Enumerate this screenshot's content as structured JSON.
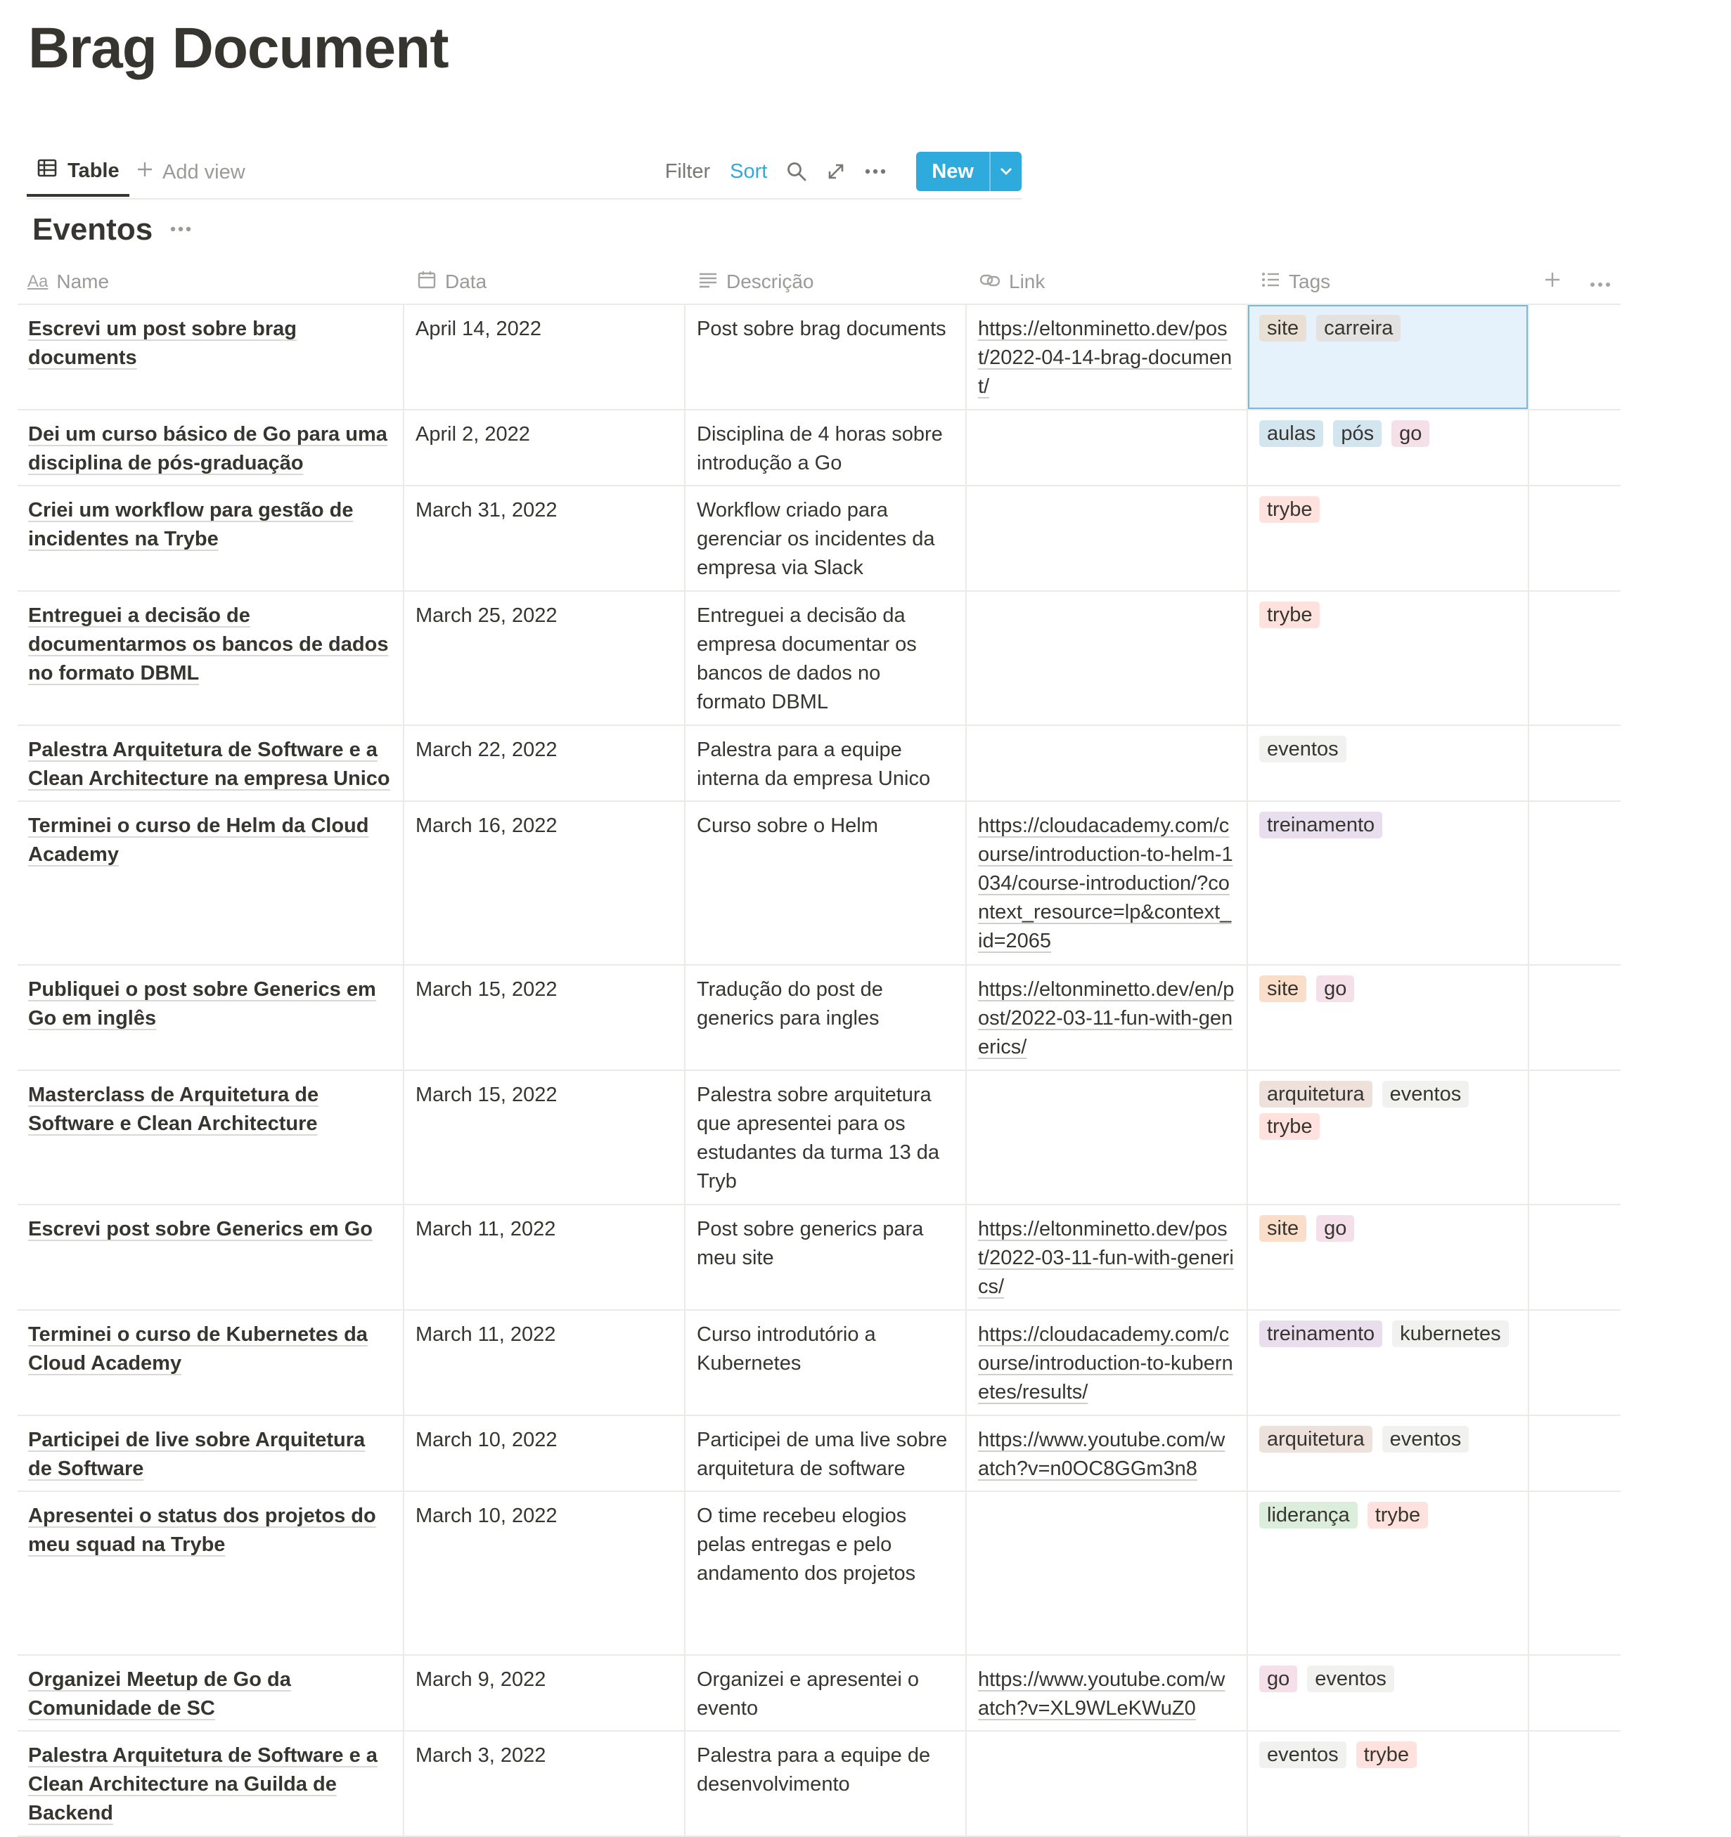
{
  "page": {
    "title": "Brag Document"
  },
  "toolbar": {
    "view_label": "Table",
    "add_view_label": "Add view",
    "filter_label": "Filter",
    "sort_label": "Sort",
    "new_label": "New"
  },
  "group": {
    "title": "Eventos"
  },
  "columns": [
    "Name",
    "Data",
    "Descrição",
    "Link",
    "Tags"
  ],
  "tag_colors": {
    "site": "#e9e0d3",
    "carreira": "#e3e2e0",
    "aulas": "#d3e5ef",
    "pós": "#d3e5ef",
    "go": "#f5e0e9",
    "trybe": "#ffe2dd",
    "eventos": "#f1f1ef",
    "treinamento": "#e8deee",
    "site_orange": "#fadec9",
    "arquitetura": "#eee0da",
    "kubernetes": "#f1f1ef",
    "liderança": "#dbeddb"
  },
  "rows": [
    {
      "name": "Escrevi um post sobre brag documents",
      "date": "April 14, 2022",
      "desc": "Post sobre brag documents",
      "link": "https://eltonminetto.dev/post/2022-04-14-brag-document/",
      "tags": [
        [
          "site",
          "#e9e0d3"
        ],
        [
          "carreira",
          "#e3e2e0"
        ]
      ],
      "selected": true,
      "height": 90
    },
    {
      "name": "Dei um curso básico de Go para uma disciplina de pós-graduação",
      "date": "April 2, 2022",
      "desc": "Disciplina de 4 horas sobre introdução a Go",
      "link": "",
      "tags": [
        [
          "aulas",
          "#d3e5ef"
        ],
        [
          "pós",
          "#d3e5ef"
        ],
        [
          "go",
          "#f5e0e9"
        ]
      ],
      "height": 65
    },
    {
      "name": "Criei um workflow para gestão de incidentes na Trybe",
      "date": "March 31, 2022",
      "desc": "Workflow criado para gerenciar os incidentes da empresa via Slack",
      "link": "",
      "tags": [
        [
          "trybe",
          "#ffe2dd"
        ]
      ],
      "height": 90
    },
    {
      "name": "Entreguei a decisão de documentarmos os bancos de dados no formato DBML",
      "date": "March 25, 2022",
      "desc": "Entreguei a decisão da empresa documentar os bancos de dados no formato DBML",
      "link": "",
      "tags": [
        [
          "trybe",
          "#ffe2dd"
        ]
      ],
      "height": 115
    },
    {
      "name": "Palestra Arquitetura de Software e a Clean Architecture na empresa Unico",
      "date": "March 22, 2022",
      "desc": "Palestra para a equipe interna da empresa Unico",
      "link": "",
      "tags": [
        [
          "eventos",
          "#f1f1ef"
        ]
      ],
      "height": 65
    },
    {
      "name": "Terminei o curso de Helm da Cloud Academy",
      "date": "March 16, 2022",
      "desc": "Curso sobre o Helm",
      "link": "https://cloudacademy.com/course/introduction-to-helm-1034/course-introduction/?context_resource=lp&context_id=2065",
      "tags": [
        [
          "treinamento",
          "#e8deee"
        ]
      ],
      "height": 140
    },
    {
      "name": "Publiquei o post sobre Generics em Go em inglês",
      "date": "March 15, 2022",
      "desc": "Tradução do post de generics para ingles",
      "link": "https://eltonminetto.dev/en/post/2022-03-11-fun-with-generics/",
      "tags": [
        [
          "site",
          "#fadec9"
        ],
        [
          "go",
          "#f5e0e9"
        ]
      ],
      "height": 90
    },
    {
      "name": "Masterclass de Arquitetura de Software e Clean Architecture",
      "date": "March 15, 2022",
      "desc": "Palestra sobre arquitetura que apresentei para os estudantes da turma 13 da Tryb",
      "link": "",
      "tags": [
        [
          "arquitetura",
          "#eee0da"
        ],
        [
          "eventos",
          "#f1f1ef"
        ],
        [
          "trybe",
          "#ffe2dd"
        ]
      ],
      "height": 115
    },
    {
      "name": "Escrevi post sobre Generics em Go",
      "date": "March 11, 2022",
      "desc": "Post sobre generics para meu site",
      "link": "https://eltonminetto.dev/post/2022-03-11-fun-with-generics/",
      "tags": [
        [
          "site",
          "#fadec9"
        ],
        [
          "go",
          "#f5e0e9"
        ]
      ],
      "height": 90
    },
    {
      "name": "Terminei o curso de Kubernetes da Cloud Academy",
      "date": "March 11, 2022",
      "desc": "Curso introdutório a Kubernetes",
      "link": "https://cloudacademy.com/course/introduction-to-kubernetes/results/",
      "tags": [
        [
          "treinamento",
          "#e8deee"
        ],
        [
          "kubernetes",
          "#f1f1ef"
        ]
      ],
      "height": 90
    },
    {
      "name": "Participei de live sobre Arquitetura de Software",
      "date": "March 10, 2022",
      "desc": "Participei de uma live sobre arquitetura de software",
      "link": "https://www.youtube.com/watch?v=n0OC8GGm3n8",
      "tags": [
        [
          "arquitetura",
          "#eee0da"
        ],
        [
          "eventos",
          "#f1f1ef"
        ]
      ],
      "height": 65
    },
    {
      "name": "Apresentei o status dos projetos do meu squad na Trybe",
      "date": "March 10, 2022",
      "desc": "O time recebeu elogios pelas entregas e pelo andamento dos projetos",
      "link": "",
      "tags": [
        [
          "liderança",
          "#dbeddb"
        ],
        [
          "trybe",
          "#ffe2dd"
        ]
      ],
      "height": 140
    },
    {
      "name": "Organizei Meetup de Go da Comunidade de SC",
      "date": "March 9, 2022",
      "desc": "Organizei e apresentei o evento",
      "link": "https://www.youtube.com/watch?v=XL9WLeKWuZ0",
      "tags": [
        [
          "go",
          "#f5e0e9"
        ],
        [
          "eventos",
          "#f1f1ef"
        ]
      ],
      "height": 65
    },
    {
      "name": "Palestra Arquitetura de Software e a Clean Architecture na Guilda de Backend",
      "date": "March 3, 2022",
      "desc": "Palestra para a equipe de desenvolvimento",
      "link": "",
      "tags": [
        [
          "eventos",
          "#f1f1ef"
        ],
        [
          "trybe",
          "#ffe2dd"
        ]
      ],
      "height": 90
    }
  ]
}
